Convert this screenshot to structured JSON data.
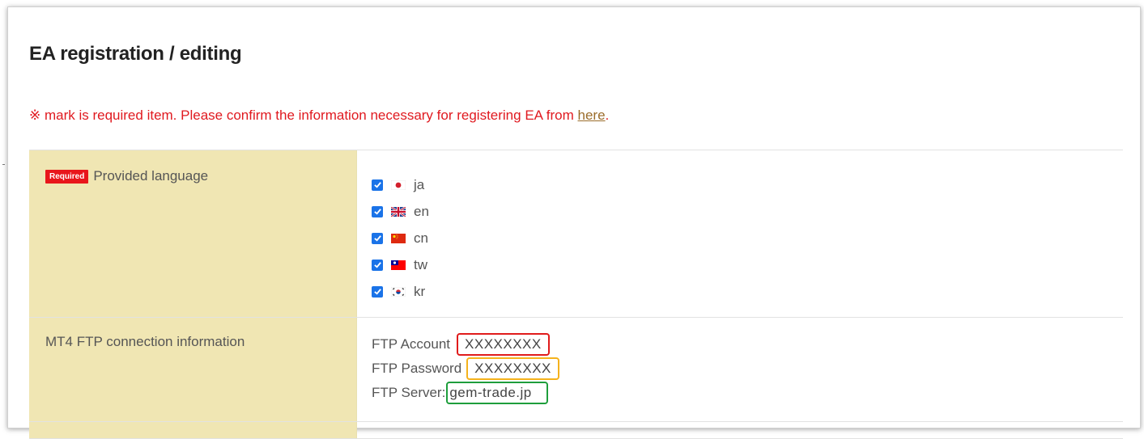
{
  "page": {
    "title": "EA registration / editing",
    "notice_prefix": "※ mark is required item. Please confirm the information necessary for registering EA from ",
    "notice_link": "here",
    "notice_suffix": "."
  },
  "form": {
    "required_badge": "Required",
    "language_row": {
      "label": "Provided language",
      "options": [
        {
          "code": "ja",
          "checked": true,
          "flag": "japan-flag"
        },
        {
          "code": "en",
          "checked": true,
          "flag": "uk-flag"
        },
        {
          "code": "cn",
          "checked": true,
          "flag": "china-flag"
        },
        {
          "code": "tw",
          "checked": true,
          "flag": "taiwan-flag"
        },
        {
          "code": "kr",
          "checked": true,
          "flag": "korea-flag"
        }
      ]
    },
    "ftp_row": {
      "label": "MT4 FTP connection information",
      "account_label": "FTP Account",
      "account_value": "XXXXXXXX",
      "password_label": "FTP Password",
      "password_value": "XXXXXXXX",
      "server_label": "FTP Server:",
      "server_value": "gem-trade.jp"
    }
  },
  "colors": {
    "label_bg": "#f0e6b3",
    "required_red": "#e8161b",
    "notice_red": "#e0191f",
    "link_brown": "#9b6d2b",
    "checkbox_blue": "#1a73e8",
    "highlight_red": "#e01b1b",
    "highlight_orange": "#f5b21c",
    "highlight_green": "#1e9e3c"
  }
}
